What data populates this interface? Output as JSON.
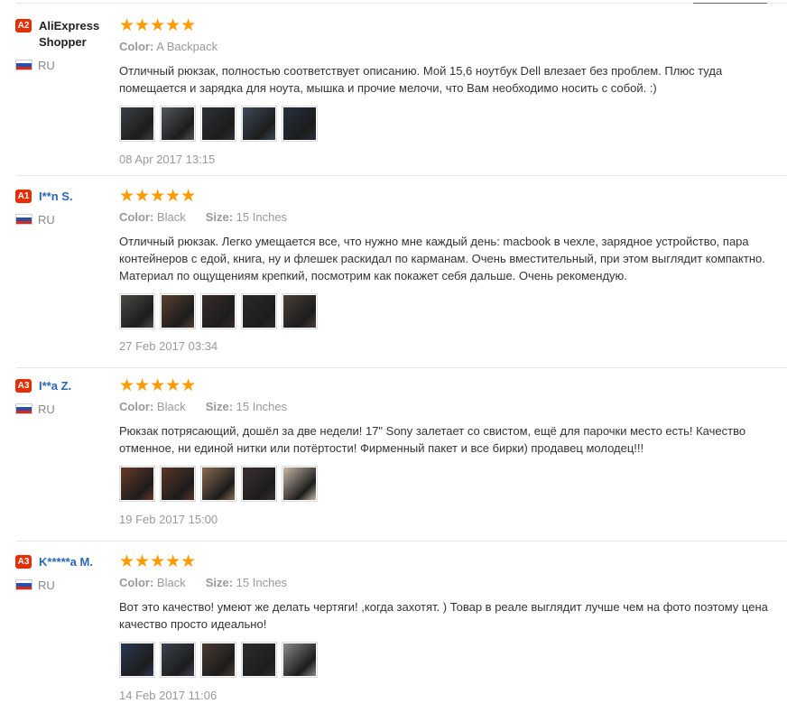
{
  "reviews": [
    {
      "level": "A2",
      "name": "AliExpress Shopper",
      "name_style": "plain",
      "country": "RU",
      "rating": 5,
      "stars": "★★★★★",
      "props": [
        {
          "label": "Color:",
          "value": "A Backpack"
        }
      ],
      "text": "Отличный рюкзак, полностью соответствует описанию. Мой 15,6 ноутбук Dell влезает без проблем. Плюс туда помещается и зарядка для ноута, мышка и прочие мелочи, что Вам необходимо носить с собой. :)",
      "photos": [
        "#3a3f44",
        "#52565a",
        "#2e3135",
        "#3d4b5a",
        "#263040"
      ],
      "date": "08 Apr 2017 13:15"
    },
    {
      "level": "A1",
      "name": "I**n S.",
      "name_style": "link",
      "country": "RU",
      "rating": 5,
      "stars": "★★★★★",
      "props": [
        {
          "label": "Color:",
          "value": "Black"
        },
        {
          "label": "Size:",
          "value": "15 Inches"
        }
      ],
      "text": "Отличный рюкзак. Легко умещается все, что нужно мне каждый день: macbook в чехле, зарядное устройство, пара контейнеров с едой, книга, ну и флешек раскидал по карманам. Очень вместительный, при этом выглядит компактно. Материал по ощущениям крепкий, посмотрим как покажет себя дальше. Очень рекомендую.",
      "photos": [
        "#4a4a46",
        "#5a4030",
        "#3a2a2a",
        "#2a2a2a",
        "#4a4038"
      ],
      "date": "27 Feb 2017 03:34"
    },
    {
      "level": "A3",
      "name": "I**a Z.",
      "name_style": "link",
      "country": "RU",
      "rating": 5,
      "stars": "★★★★★",
      "props": [
        {
          "label": "Color:",
          "value": "Black"
        },
        {
          "label": "Size:",
          "value": "15 Inches"
        }
      ],
      "text": "Рюкзак потрясающий, дошёл за две недели! 17\" Sony залетает со свистом, ещё для парочки место есть! Качество отменное, ни единой нитки или потёртости! Фирменный пакет и все бирки) продавец молодец!!!",
      "photos": [
        "#6a3a28",
        "#5a3526",
        "#8a6a50",
        "#3a3030",
        "#c8b8a8"
      ],
      "date": "19 Feb 2017 15:00"
    },
    {
      "level": "A3",
      "name": "K*****a M.",
      "name_style": "link",
      "country": "RU",
      "rating": 5,
      "stars": "★★★★★",
      "props": [
        {
          "label": "Color:",
          "value": "Black"
        },
        {
          "label": "Size:",
          "value": "15 Inches"
        }
      ],
      "text": "Вот это качество! умеют же делать чертяги! ,когда захотят. ) Товар в реале выглядит лучше чем на фото поэтому цена качество просто идеально!",
      "photos": [
        "#2a3a55",
        "#3a4250",
        "#4a3a30",
        "#2e2e30",
        "#8a8a8a"
      ],
      "date": "14 Feb 2017 11:06"
    }
  ],
  "colors": {
    "level_badge": "#e62e04",
    "star": "#ff9a00",
    "link": "#2c66b8"
  }
}
